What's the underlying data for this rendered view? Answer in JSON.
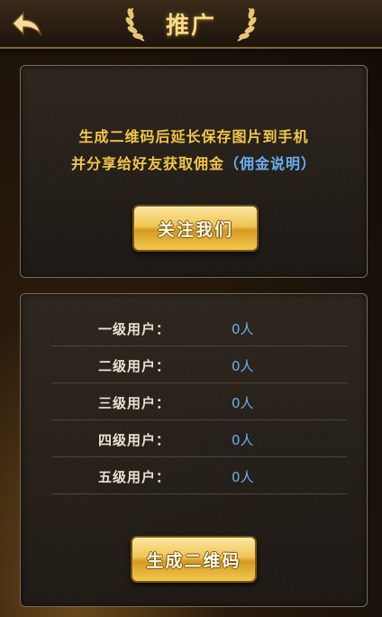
{
  "header": {
    "title": "推广"
  },
  "intro": {
    "line1": "生成二维码后延长保存图片到手机",
    "line2_prefix": "并分享给好友获取佣金",
    "commission_link": "（佣金说明）"
  },
  "follow_button": "关注我们",
  "levels": [
    {
      "label": "一级用户：",
      "value": "0人"
    },
    {
      "label": "二级用户：",
      "value": "0人"
    },
    {
      "label": "三级用户：",
      "value": "0人"
    },
    {
      "label": "四级用户：",
      "value": "0人"
    },
    {
      "label": "五级用户：",
      "value": "0人"
    }
  ],
  "generate_button": "生成二维码",
  "colors": {
    "gold_text": "#f2c648",
    "link_blue": "#6ab0f0",
    "button_gold": "#f0c554"
  },
  "icons": {
    "back": "back-arrow-icon",
    "laurel_left": "laurel-left-icon",
    "laurel_right": "laurel-right-icon"
  }
}
